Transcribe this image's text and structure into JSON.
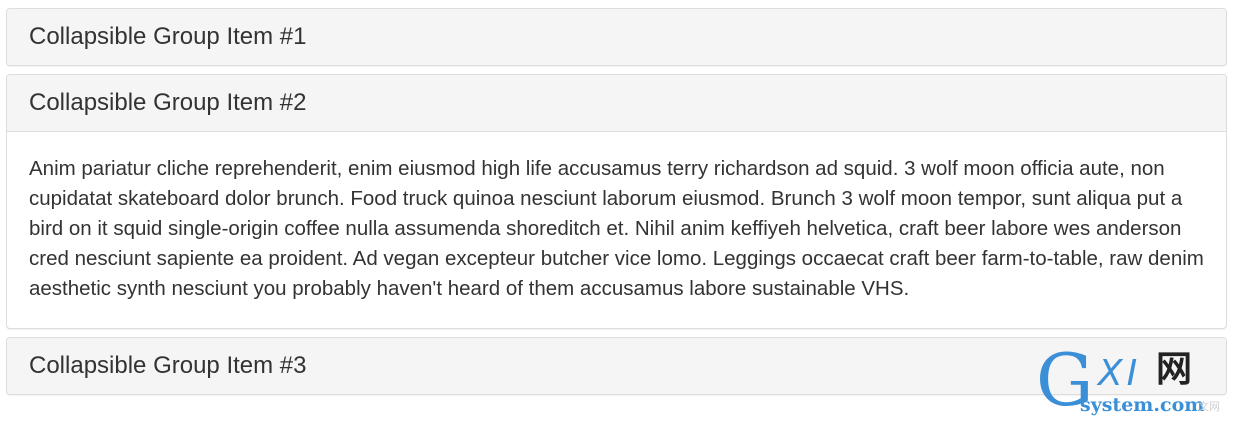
{
  "accordion": {
    "panels": [
      {
        "title": "Collapsible Group Item #1",
        "expanded": false,
        "body": ""
      },
      {
        "title": "Collapsible Group Item #2",
        "expanded": true,
        "body": "Anim pariatur cliche reprehenderit, enim eiusmod high life accusamus terry richardson ad squid. 3 wolf moon officia aute, non cupidatat skateboard dolor brunch. Food truck quinoa nesciunt laborum eiusmod. Brunch 3 wolf moon tempor, sunt aliqua put a bird on it squid single-origin coffee nulla assumenda shoreditch et. Nihil anim keffiyeh helvetica, craft beer labore wes anderson cred nesciunt sapiente ea proident. Ad vegan excepteur butcher vice lomo. Leggings occaecat craft beer farm-to-table, raw denim aesthetic synth nesciunt you probably haven't heard of them accusamus labore sustainable VHS."
      },
      {
        "title": "Collapsible Group Item #3",
        "expanded": false,
        "body": ""
      }
    ]
  },
  "watermark": {
    "logo_letter": "G",
    "logo_xi": "XI",
    "logo_wang": "网",
    "domain": "system.com",
    "subtitle": "文网"
  },
  "colors": {
    "heading_bg": "#f5f5f5",
    "border": "#dddddd",
    "text": "#333333",
    "watermark_blue": "#3b8fd6"
  }
}
